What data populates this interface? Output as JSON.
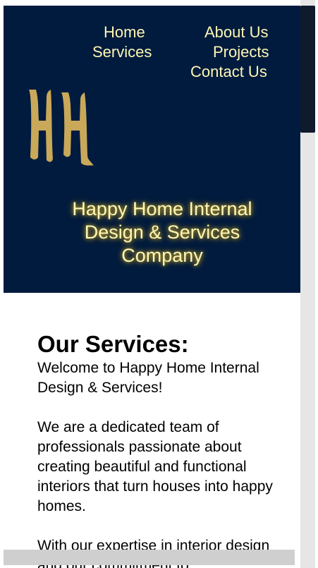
{
  "nav": {
    "home": "Home",
    "about": "About Us",
    "services": "Services",
    "projects": "Projects",
    "contact": "Contact Us"
  },
  "hero": {
    "logo_text": "HH",
    "company_name": "Happy Home Internal Design & Services Company",
    "background_color": "#001b3e",
    "accent_color": "#fff7b5"
  },
  "services": {
    "heading": "Our Services:",
    "paragraphs": [
      "Welcome to Happy Home Internal Design & Services!",
      "We are a dedicated team of professionals passionate about creating beautiful and functional interiors that turn houses into happy homes.",
      "With our expertise in interior design and our commitment to"
    ]
  }
}
